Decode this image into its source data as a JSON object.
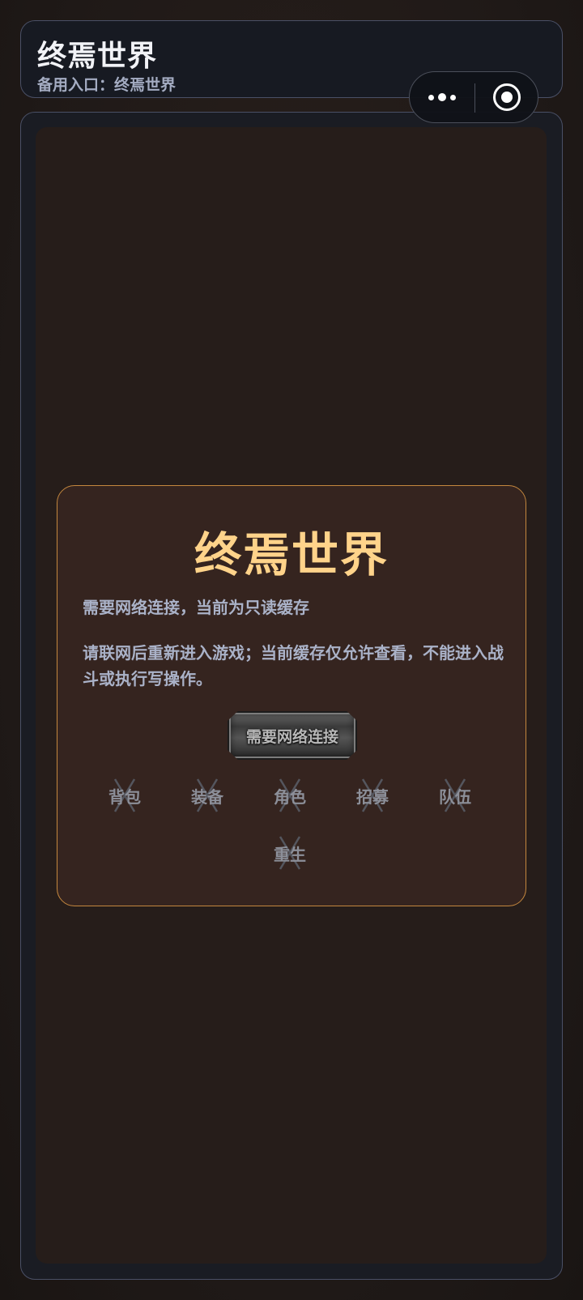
{
  "header": {
    "title": "终焉世界",
    "alt_entry": "备用入口：终焉世界"
  },
  "capsule": {
    "more_icon": "more-dots-icon",
    "close_icon": "target-circle-icon"
  },
  "dialog": {
    "title": "终焉世界",
    "subtitle": "需要网络连接，当前为只读缓存",
    "message": "请联网后重新进入游戏；当前缓存仅允许查看，不能进入战斗或执行写操作。",
    "button_label": "需要网络连接",
    "actions": [
      {
        "label": "背包"
      },
      {
        "label": "装备"
      },
      {
        "label": "角色"
      },
      {
        "label": "招募"
      },
      {
        "label": "队伍"
      },
      {
        "label": "重生"
      }
    ]
  },
  "colors": {
    "background": "#231c1a",
    "panel": "#171a22",
    "border": "#4a5066",
    "dialog_bg": "#35241f",
    "dialog_border": "#c4873e",
    "title_gold": "#ffd38a",
    "text_muted": "#aab2c8"
  }
}
